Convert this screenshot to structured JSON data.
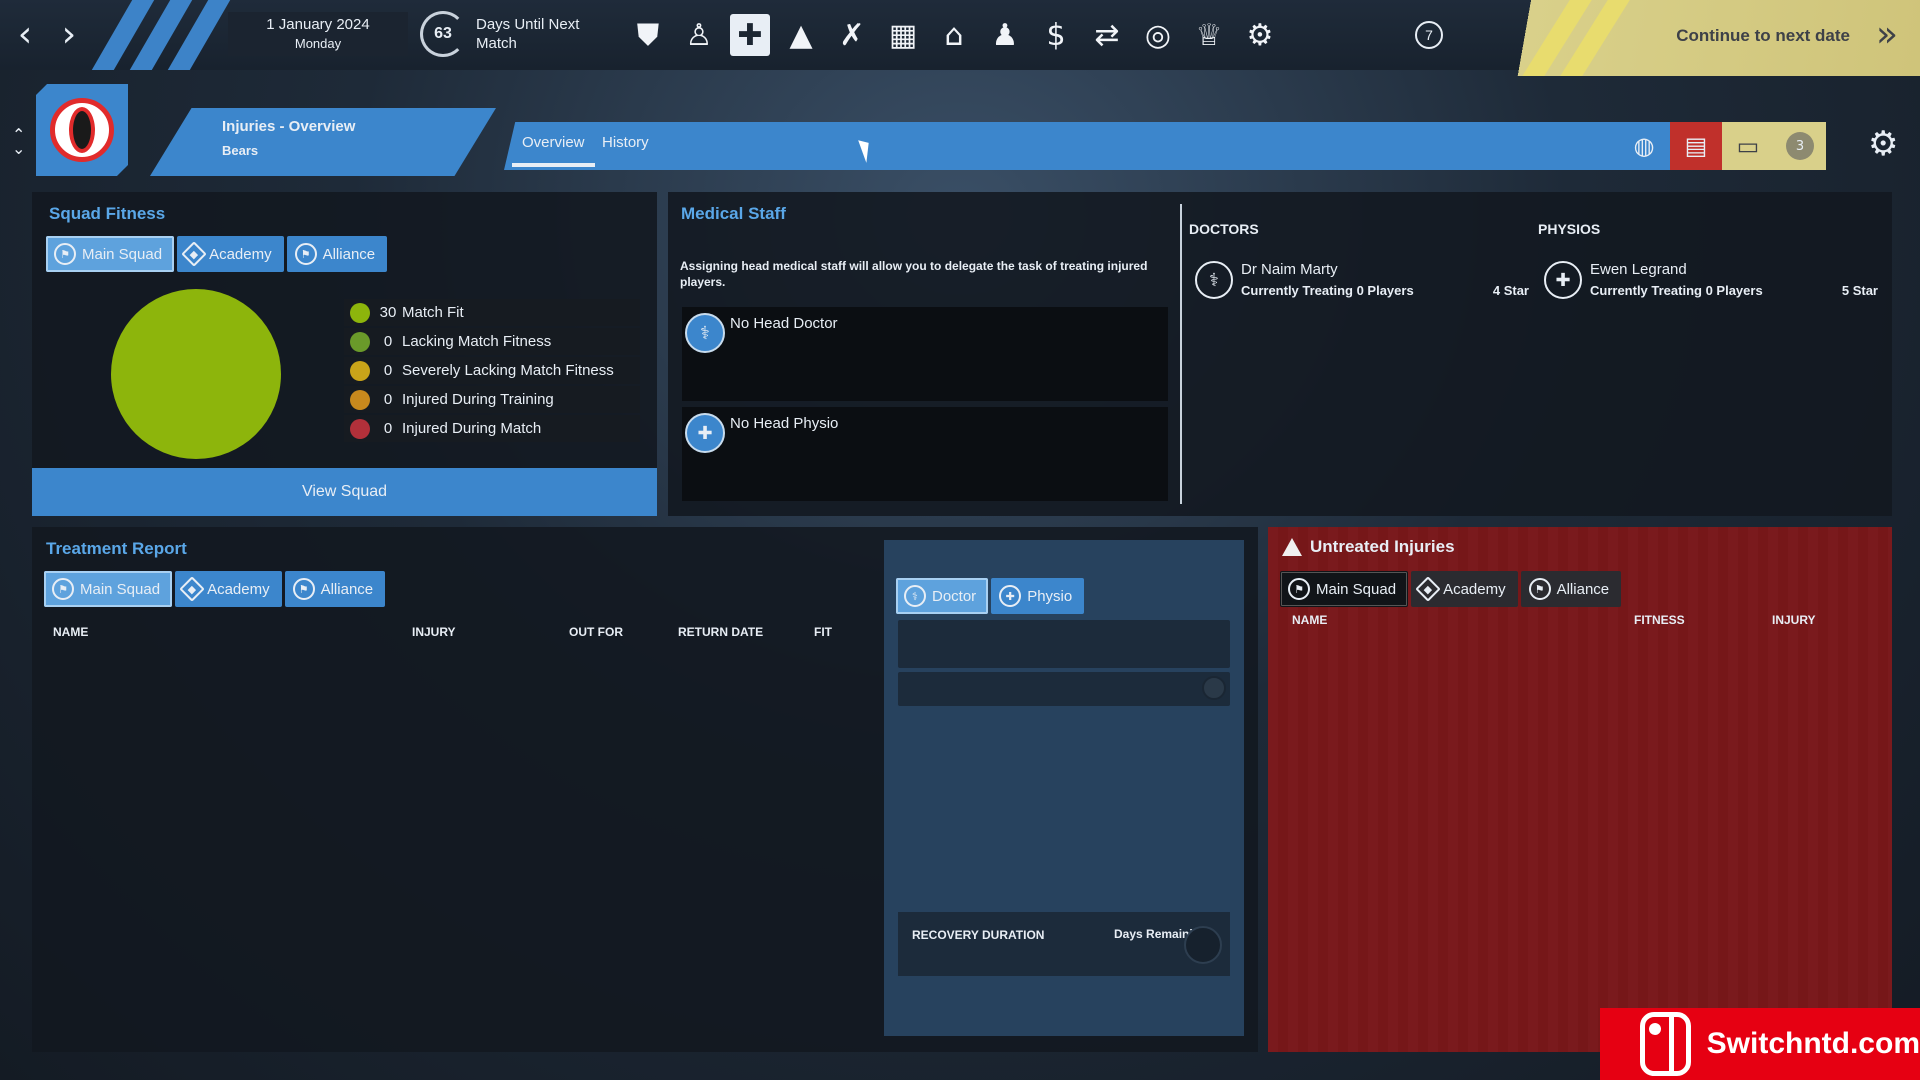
{
  "topbar": {
    "date": "1 January 2024",
    "weekday": "Monday",
    "days_until": "63",
    "days_until_label": "Days Until Next Match",
    "counter": "7",
    "continue_label": "Continue to next date",
    "icons": [
      "shield-icon",
      "players-icon",
      "medical-icon",
      "cone-icon",
      "tactics-icon",
      "calendar-icon",
      "home-icon",
      "staff-icon",
      "finance-icon",
      "transfer-icon",
      "scouting-icon",
      "trophy-icon",
      "settings-group-icon"
    ]
  },
  "header": {
    "page_title": "Injuries - Overview",
    "club_name": "Bears",
    "tabs": [
      {
        "label": "Overview"
      },
      {
        "label": "History"
      }
    ],
    "badge_count": "3"
  },
  "squad_fitness": {
    "title": "Squad Fitness",
    "filters": [
      "Main Squad",
      "Academy",
      "Alliance"
    ],
    "legend": [
      {
        "count": "30",
        "label": "Match Fit",
        "color": "#8db50c"
      },
      {
        "count": "0",
        "label": "Lacking Match Fitness",
        "color": "#6a9a2a"
      },
      {
        "count": "0",
        "label": "Severely Lacking Match Fitness",
        "color": "#c9a419"
      },
      {
        "count": "0",
        "label": "Injured During Training",
        "color": "#c8891d"
      },
      {
        "count": "0",
        "label": "Injured During Match",
        "color": "#b2303a"
      }
    ],
    "view_squad_label": "View Squad"
  },
  "medical_staff": {
    "title": "Medical Staff",
    "description": "Assigning head medical staff will allow you to delegate the task of treating injured players.",
    "head_doctor": "No Head Doctor",
    "head_physio": "No Head Physio",
    "doctors_header": "DOCTORS",
    "physios_header": "PHYSIOS",
    "doctor": {
      "name": "Dr Naim Marty",
      "status": "Currently Treating 0 Players",
      "rating": "4 Star"
    },
    "physio": {
      "name": "Ewen Legrand",
      "status": "Currently Treating 0 Players",
      "rating": "5 Star"
    }
  },
  "treatment_report": {
    "title": "Treatment Report",
    "filters": [
      "Main Squad",
      "Academy",
      "Alliance"
    ],
    "columns": [
      "NAME",
      "INJURY",
      "OUT FOR",
      "RETURN DATE",
      "FIT"
    ],
    "staff_tabs": [
      "Doctor",
      "Physio"
    ],
    "recovery_label": "RECOVERY DURATION",
    "days_remaining_label": "Days Remaining"
  },
  "untreated": {
    "title": "Untreated Injuries",
    "filters": [
      "Main Squad",
      "Academy",
      "Alliance"
    ],
    "columns": [
      "NAME",
      "FITNESS",
      "INJURY"
    ]
  },
  "watermark": "Switchntd.com"
}
